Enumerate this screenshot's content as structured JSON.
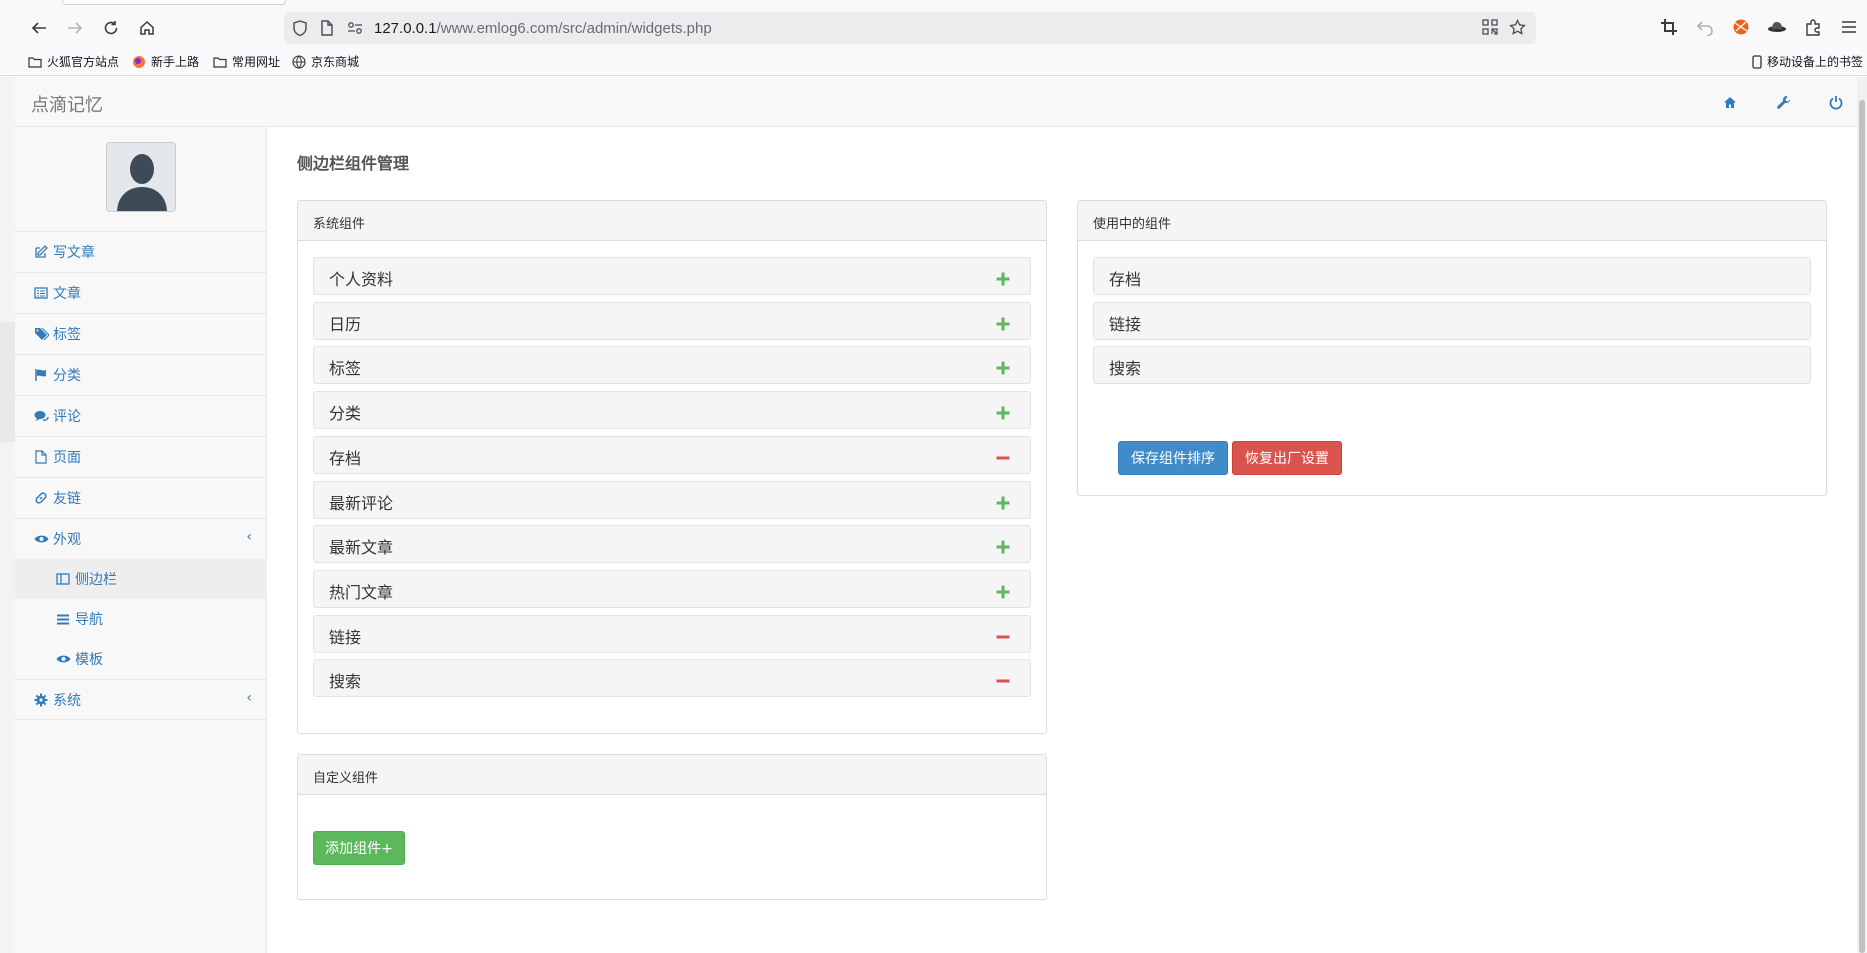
{
  "browser": {
    "url_host": "127.0.0.1",
    "url_path": "/www.emlog6.com/src/admin/widgets.php",
    "bookmarks": [
      "火狐官方站点",
      "新手上路",
      "常用网址",
      "京东商城"
    ],
    "mobile_bookmarks": "移动设备上的书签"
  },
  "app": {
    "brand": "点滴记忆"
  },
  "sidebar": {
    "items": [
      {
        "label": "写文章",
        "icon": "edit-icon"
      },
      {
        "label": "文章",
        "icon": "list-alt-icon"
      },
      {
        "label": "标签",
        "icon": "tags-icon"
      },
      {
        "label": "分类",
        "icon": "flag-icon"
      },
      {
        "label": "评论",
        "icon": "comments-icon"
      },
      {
        "label": "页面",
        "icon": "file-icon"
      },
      {
        "label": "友链",
        "icon": "link-icon"
      },
      {
        "label": "外观",
        "icon": "eye-icon"
      },
      {
        "label": "系统",
        "icon": "cog-icon"
      }
    ],
    "appearance_sub": [
      {
        "label": "侧边栏",
        "icon": "columns-icon",
        "active": true
      },
      {
        "label": "导航",
        "icon": "bars-icon",
        "active": false
      },
      {
        "label": "模板",
        "icon": "eye-icon",
        "active": false
      }
    ]
  },
  "main": {
    "title": "侧边栏组件管理",
    "system_panel": {
      "heading": "系统组件",
      "widgets": [
        {
          "label": "个人资料",
          "action": "add"
        },
        {
          "label": "日历",
          "action": "add"
        },
        {
          "label": "标签",
          "action": "add"
        },
        {
          "label": "分类",
          "action": "add"
        },
        {
          "label": "存档",
          "action": "remove"
        },
        {
          "label": "最新评论",
          "action": "add"
        },
        {
          "label": "最新文章",
          "action": "add"
        },
        {
          "label": "热门文章",
          "action": "add"
        },
        {
          "label": "链接",
          "action": "remove"
        },
        {
          "label": "搜索",
          "action": "remove"
        }
      ]
    },
    "custom_panel": {
      "heading": "自定义组件",
      "add_button": "添加组件+"
    },
    "active_panel": {
      "heading": "使用中的组件",
      "widgets": [
        "存档",
        "链接",
        "搜索"
      ],
      "save_button": "保存组件排序",
      "reset_button": "恢复出厂设置"
    }
  },
  "colors": {
    "link": "#337ab7",
    "add": "#5cb85c",
    "remove": "#d9534f",
    "primary": "#428bca"
  }
}
